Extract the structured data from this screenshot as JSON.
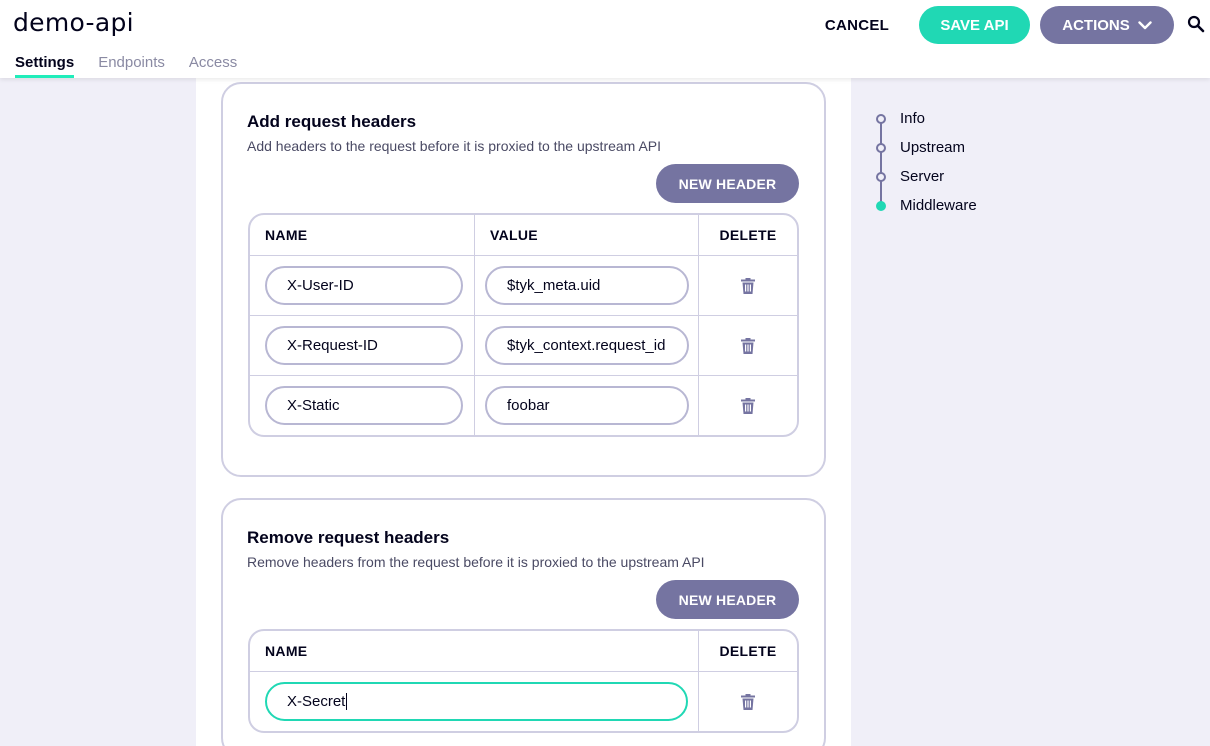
{
  "app": {
    "title": "demo-api"
  },
  "tabs": [
    {
      "label": "Settings",
      "active": true
    },
    {
      "label": "Endpoints",
      "active": false
    },
    {
      "label": "Access",
      "active": false
    }
  ],
  "toolbar": {
    "cancel_label": "CANCEL",
    "save_label": "SAVE API",
    "actions_label": "ACTIONS"
  },
  "add_headers": {
    "title": "Add request headers",
    "subtitle": "Add headers to the request before it is proxied to the upstream API",
    "new_button": "NEW HEADER",
    "columns": [
      "NAME",
      "VALUE",
      "DELETE"
    ],
    "rows": [
      {
        "name": "X-User-ID",
        "value": "$tyk_meta.uid"
      },
      {
        "name": "X-Request-ID",
        "value": "$tyk_context.request_id"
      },
      {
        "name": "X-Static",
        "value": "foobar"
      }
    ]
  },
  "remove_headers": {
    "title": "Remove request headers",
    "subtitle": "Remove headers from the request before it is proxied to the upstream API",
    "new_button": "NEW HEADER",
    "columns": [
      "NAME",
      "DELETE"
    ],
    "rows": [
      {
        "name": "X-Secret"
      }
    ]
  },
  "side_nav": {
    "items": [
      {
        "label": "Info",
        "active": false
      },
      {
        "label": "Upstream",
        "active": false
      },
      {
        "label": "Server",
        "active": false
      },
      {
        "label": "Middleware",
        "active": true
      }
    ]
  },
  "colors": {
    "accent": "#20d8b4",
    "secondary": "#7574a1",
    "border": "#cfcee2",
    "background": "#f0eff8"
  }
}
